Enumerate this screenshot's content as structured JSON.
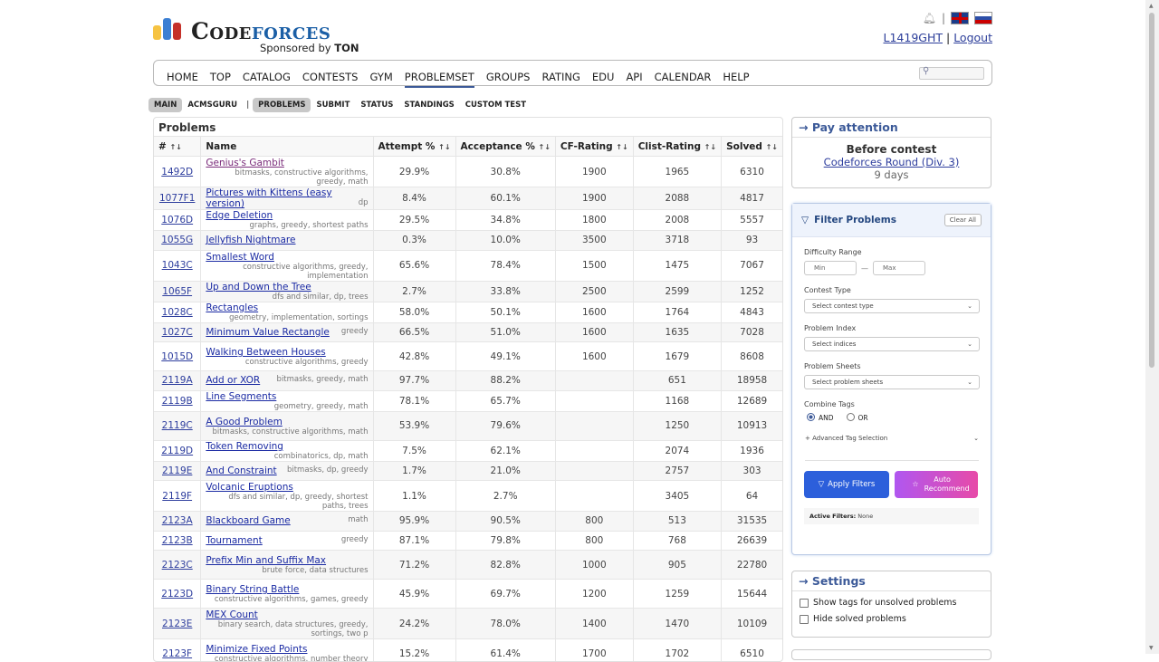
{
  "header": {
    "logo_code": "Code",
    "logo_forces": "forces",
    "sponsor_prefix": "Sponsored by",
    "sponsor_name": "TON",
    "username": "L1419GHT",
    "separator": "|",
    "logout": "Logout",
    "colors": {
      "bar1": "#f6c342",
      "bar2": "#3b7fd3",
      "bar3": "#c5312a",
      "brand": "#1b5fa6"
    }
  },
  "menu": {
    "items": [
      "HOME",
      "TOP",
      "CATALOG",
      "CONTESTS",
      "GYM",
      "PROBLEMSET",
      "GROUPS",
      "RATING",
      "EDU",
      "API",
      "CALENDAR",
      "HELP"
    ],
    "active": "PROBLEMSET"
  },
  "submenu": {
    "main": "MAIN",
    "acmsguru": "ACMSGURU",
    "divider": "|",
    "problems": "PROBLEMS",
    "submit": "SUBMIT",
    "status": "STATUS",
    "standings": "STANDINGS",
    "custom_test": "CUSTOM TEST"
  },
  "problems": {
    "title": "Problems",
    "columns": {
      "id": "#",
      "name": "Name",
      "attempt": "Attempt %",
      "acceptance": "Acceptance %",
      "cf": "CF-Rating",
      "clist": "Clist-Rating",
      "solved": "Solved"
    },
    "sort_arrows": "↑↓",
    "rows": [
      {
        "id": "1492D",
        "name": "Genius's Gambit",
        "tags": "bitmasks, constructive algorithms, greedy, math",
        "attempt": "29.9%",
        "acceptance": "30.8%",
        "cf": "1900",
        "clist": "1965",
        "solved": "6310",
        "two": true,
        "visited": true
      },
      {
        "id": "1077F1",
        "name": "Pictures with Kittens (easy version)",
        "tags": "dp",
        "attempt": "8.4%",
        "acceptance": "60.1%",
        "cf": "1900",
        "clist": "2088",
        "solved": "4817",
        "two": false
      },
      {
        "id": "1076D",
        "name": "Edge Deletion",
        "tags": "graphs, greedy, shortest paths",
        "attempt": "29.5%",
        "acceptance": "34.8%",
        "cf": "1800",
        "clist": "2008",
        "solved": "5557",
        "two": false
      },
      {
        "id": "1055G",
        "name": "Jellyfish Nightmare",
        "tags": "",
        "attempt": "0.3%",
        "acceptance": "10.0%",
        "cf": "3500",
        "clist": "3718",
        "solved": "93",
        "two": false
      },
      {
        "id": "1043C",
        "name": "Smallest Word",
        "tags": "constructive algorithms, greedy, implementation",
        "attempt": "65.6%",
        "acceptance": "78.4%",
        "cf": "1500",
        "clist": "1475",
        "solved": "7067",
        "two": true
      },
      {
        "id": "1065F",
        "name": "Up and Down the Tree",
        "tags": "dfs and similar, dp, trees",
        "attempt": "2.7%",
        "acceptance": "33.8%",
        "cf": "2500",
        "clist": "2599",
        "solved": "1252",
        "two": false
      },
      {
        "id": "1028C",
        "name": "Rectangles",
        "tags": "geometry, implementation, sortings",
        "attempt": "58.0%",
        "acceptance": "50.1%",
        "cf": "1600",
        "clist": "1764",
        "solved": "4843",
        "two": false
      },
      {
        "id": "1027C",
        "name": "Minimum Value Rectangle",
        "tags": "greedy",
        "attempt": "66.5%",
        "acceptance": "51.0%",
        "cf": "1600",
        "clist": "1635",
        "solved": "7028",
        "two": false
      },
      {
        "id": "1015D",
        "name": "Walking Between Houses",
        "tags": "constructive algorithms, greedy",
        "attempt": "42.8%",
        "acceptance": "49.1%",
        "cf": "1600",
        "clist": "1679",
        "solved": "8608",
        "two": true
      },
      {
        "id": "2119A",
        "name": "Add or XOR",
        "tags": "bitmasks, greedy, math",
        "attempt": "97.7%",
        "acceptance": "88.2%",
        "cf": "",
        "clist": "651",
        "solved": "18958",
        "two": false
      },
      {
        "id": "2119B",
        "name": "Line Segments",
        "tags": "geometry, greedy, math",
        "attempt": "78.1%",
        "acceptance": "65.7%",
        "cf": "",
        "clist": "1168",
        "solved": "12689",
        "two": false
      },
      {
        "id": "2119C",
        "name": "A Good Problem",
        "tags": "bitmasks, constructive algorithms, math",
        "attempt": "53.9%",
        "acceptance": "79.6%",
        "cf": "",
        "clist": "1250",
        "solved": "10913",
        "two": true
      },
      {
        "id": "2119D",
        "name": "Token Removing",
        "tags": "combinatorics, dp, math",
        "attempt": "7.5%",
        "acceptance": "62.1%",
        "cf": "",
        "clist": "2074",
        "solved": "1936",
        "two": false
      },
      {
        "id": "2119E",
        "name": "And Constraint",
        "tags": "bitmasks, dp, greedy",
        "attempt": "1.7%",
        "acceptance": "21.0%",
        "cf": "",
        "clist": "2757",
        "solved": "303",
        "two": false
      },
      {
        "id": "2119F",
        "name": "Volcanic Eruptions",
        "tags": "dfs and similar, dp, greedy, shortest paths, trees",
        "attempt": "1.1%",
        "acceptance": "2.7%",
        "cf": "",
        "clist": "3405",
        "solved": "64",
        "two": true
      },
      {
        "id": "2123A",
        "name": "Blackboard Game",
        "tags": "math",
        "attempt": "95.9%",
        "acceptance": "90.5%",
        "cf": "800",
        "clist": "513",
        "solved": "31535",
        "two": false
      },
      {
        "id": "2123B",
        "name": "Tournament",
        "tags": "greedy",
        "attempt": "87.1%",
        "acceptance": "79.8%",
        "cf": "800",
        "clist": "768",
        "solved": "26639",
        "two": false
      },
      {
        "id": "2123C",
        "name": "Prefix Min and Suffix Max",
        "tags": "brute force, data structures",
        "attempt": "71.2%",
        "acceptance": "82.8%",
        "cf": "1000",
        "clist": "905",
        "solved": "22780",
        "two": true
      },
      {
        "id": "2123D",
        "name": "Binary String Battle",
        "tags": "constructive algorithms, games, greedy",
        "attempt": "45.9%",
        "acceptance": "69.7%",
        "cf": "1200",
        "clist": "1259",
        "solved": "15644",
        "two": true
      },
      {
        "id": "2123E",
        "name": "MEX Count",
        "tags": "binary search, data structures, greedy, sortings, two p",
        "attempt": "24.2%",
        "acceptance": "78.0%",
        "cf": "1400",
        "clist": "1470",
        "solved": "10109",
        "two": true
      },
      {
        "id": "2123F",
        "name": "Minimize Fixed Points",
        "tags": "constructive algorithms, number theory",
        "attempt": "15.2%",
        "acceptance": "61.4%",
        "cf": "1700",
        "clist": "1702",
        "solved": "6510",
        "two": true
      }
    ]
  },
  "attention": {
    "arrow": "→",
    "title": "Pay attention",
    "before": "Before contest",
    "contest": "Codeforces Round (Div. 3)",
    "days": "9 days"
  },
  "filter": {
    "title": "Filter Problems",
    "clear": "Clear All",
    "difficulty": "Difficulty Range",
    "min": "Min",
    "max": "Max",
    "dash": "—",
    "contest_type": "Contest Type",
    "contest_type_ph": "Select contest type",
    "problem_index": "Problem Index",
    "problem_index_ph": "Select indices",
    "problem_sheets": "Problem Sheets",
    "problem_sheets_ph": "Select problem sheets",
    "combine": "Combine Tags",
    "and": "AND",
    "or": "OR",
    "advanced": "Advanced Tag Selection",
    "apply": "Apply Filters",
    "auto": "Auto Recommend",
    "active_label": "Active Filters:",
    "active_value": "None"
  },
  "settings": {
    "arrow": "→",
    "title": "Settings",
    "show_tags": "Show tags for unsolved problems",
    "hide_solved": "Hide solved problems"
  }
}
